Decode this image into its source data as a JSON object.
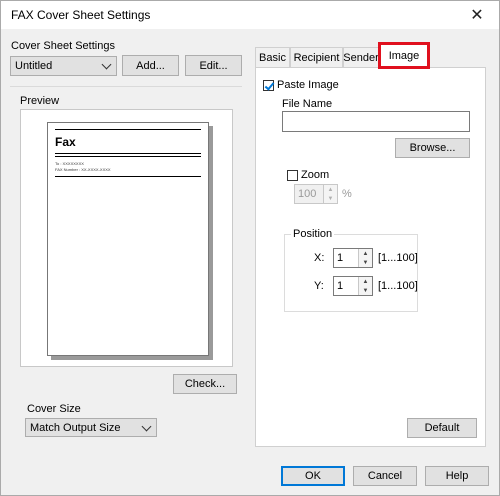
{
  "window": {
    "title": "FAX Cover Sheet Settings"
  },
  "cover_sheet": {
    "label": "Cover Sheet Settings",
    "selected": "Untitled",
    "add_label": "Add...",
    "edit_label": "Edit..."
  },
  "preview": {
    "label": "Preview",
    "page_title": "Fax",
    "line1": "To : XXXXXXXX",
    "line2": "FAX Number : XX-XXXX-XXXX"
  },
  "check_label": "Check...",
  "cover_size": {
    "label": "Cover Size",
    "selected": "Match Output Size"
  },
  "tabs": [
    {
      "label": "Basic"
    },
    {
      "label": "Recipient"
    },
    {
      "label": "Sender"
    },
    {
      "label": "Image"
    }
  ],
  "image_tab": {
    "paste_image_label": "Paste Image",
    "paste_image_checked": true,
    "file_name_label": "File Name",
    "file_name_value": "",
    "browse_label": "Browse...",
    "zoom_label": "Zoom",
    "zoom_checked": false,
    "zoom_value": "100",
    "zoom_unit": "%",
    "position_label": "Position",
    "x_label": "X:",
    "x_value": "1",
    "x_range": "[1...100]",
    "y_label": "Y:",
    "y_value": "1",
    "y_range": "[1...100]",
    "default_label": "Default"
  },
  "footer": {
    "ok_label": "OK",
    "cancel_label": "Cancel",
    "help_label": "Help"
  },
  "colors": {
    "tab_highlight": "#e0101e",
    "accent": "#0078d7"
  }
}
